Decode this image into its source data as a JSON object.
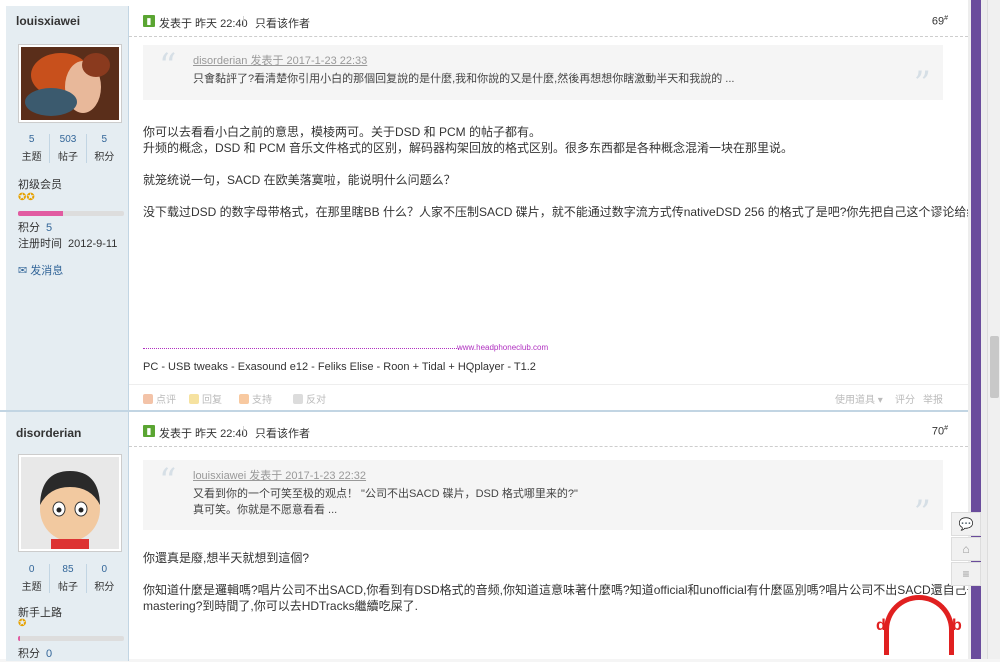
{
  "posts": [
    {
      "author": "louisxiawei",
      "stats": [
        {
          "n": "5",
          "l": "主题"
        },
        {
          "n": "503",
          "l": "帖子"
        },
        {
          "n": "5",
          "l": "积分"
        }
      ],
      "rank": "初级会员",
      "info": [
        {
          "k": "积分",
          "v": "5"
        },
        {
          "k": "注册时间",
          "v": "2012-9-11"
        }
      ],
      "send_msg": "发消息",
      "published": "发表于 昨天 22:40",
      "only_author": "只看该作者",
      "floor": "69",
      "floor_sup": "#",
      "quote_who": "disorderian 发表于 2017-1-23 22:33",
      "quote_lines": [
        "只會黏評了?看清楚你引用小白的那個回复說的是什麼,我和你說的又是什麼,然後再想想你瞎激動半天和我說的 ..."
      ],
      "body": [
        "你可以去看看小白之前的意思，模棱两可。关于DSD 和 PCM 的帖子都有。",
        "升频的概念，DSD 和 PCM 音乐文件格式的区别，解码器构架回放的格式区别。很多东西都是各种概念混淆一块在那里说。",
        "",
        "就笼统说一句，SACD 在欧美落寞啦，能说明什么问题么？",
        "",
        "没下载过DSD 的数字母带格式，在那里瞎BB 什么？人家不压制SACD 碟片，就不能通过数字流方式传nativeDSD 256 的格式了是吧?你先把自己这个谬论给纠正过来。"
      ],
      "sig_url": "www.headphoneclub.com",
      "signature": "PC - USB tweaks - Exasound e12 - Feliks Elise - Roon + Tidal + HQplayer - T1.2",
      "actions": [
        "点评",
        "回复",
        "支持",
        "反对"
      ],
      "actions_right": [
        "使用道具",
        "评分",
        "举报"
      ]
    },
    {
      "author": "disorderian",
      "stats": [
        {
          "n": "0",
          "l": "主题"
        },
        {
          "n": "85",
          "l": "帖子"
        },
        {
          "n": "0",
          "l": "积分"
        }
      ],
      "rank": "新手上路",
      "info": [
        {
          "k": "积分",
          "v": "0"
        }
      ],
      "published": "发表于 昨天 22:40",
      "only_author": "只看该作者",
      "floor": "70",
      "floor_sup": "#",
      "quote_who": "louisxiawei 发表于 2017-1-23 22:32",
      "quote_lines": [
        "又看到你的一个可笑至极的观点！ \"公司不出SACD 碟片，DSD 格式哪里来的?\"",
        "真可笑。你就是不愿意看看 ..."
      ],
      "body": [
        "你還真是廢,想半天就想到這個?",
        "",
        "你知道什麼是邏輯嗎?唱片公司不出SACD,你看到有DSD格式的音频,你知道這意味著什麼嗎?知道official和unofficial有什麼區別嗎?唱片公司不出SACD還自己去做DSD",
        "mastering?到時間了,你可以去HDTracks繼續吃屎了."
      ]
    }
  ],
  "progress": {
    "post1": 0.42,
    "post2": 0.02
  },
  "tools": [
    "💬",
    "⌂",
    "≡"
  ]
}
